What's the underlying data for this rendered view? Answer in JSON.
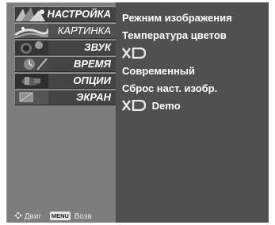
{
  "menu": {
    "items": [
      {
        "label": "НАСТРОЙКА",
        "icon": "setup-icon"
      },
      {
        "label": "КАРТИНКА",
        "icon": "picture-icon"
      },
      {
        "label": "ЗВУК",
        "icon": "audio-icon"
      },
      {
        "label": "ВРЕМЯ",
        "icon": "time-icon"
      },
      {
        "label": "ОПЦИИ",
        "icon": "option-icon"
      },
      {
        "label": "ЭКРАН",
        "icon": "screen-icon"
      }
    ],
    "active_item": "КАРТИНКА"
  },
  "submenu": {
    "items": [
      {
        "label": "Режним изображения"
      },
      {
        "label": "Температура цветов"
      },
      {
        "label": "XD",
        "type": "logo"
      },
      {
        "label": "Современный"
      },
      {
        "label": "Сброс наст. изобр."
      },
      {
        "label": "Demo",
        "logo": "XD"
      }
    ]
  },
  "footer": {
    "move_label": "Двиг",
    "menu_key": "MENU",
    "back_label": "Возв"
  },
  "colors": {
    "sidebar": "#7d7d7d",
    "content": "#505050",
    "item": "#444444",
    "text": "#ffffff"
  }
}
